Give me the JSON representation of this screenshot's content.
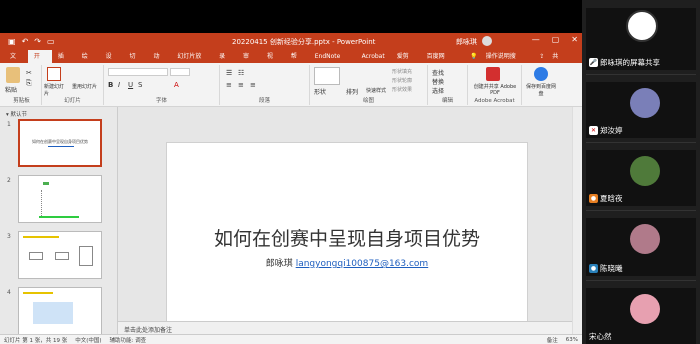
{
  "window": {
    "title": "20220415 创新经验分享.pptx - PowerPoint",
    "user": "郎咏琪"
  },
  "tabs": [
    "文件",
    "开始",
    "插入",
    "绘图",
    "设计",
    "切换",
    "动画",
    "幻灯片放映",
    "录制",
    "审阅",
    "视图",
    "帮助",
    "EndNote 20",
    "Acrobat",
    "爱剪辑",
    "百度网盘"
  ],
  "tell_me": "操作说明搜索",
  "share": "共享",
  "ribbon": {
    "groups": [
      "剪贴板",
      "幻灯片",
      "字体",
      "段落",
      "绘图",
      "编辑",
      "Adobe Acrobat",
      "保存到百度网盘"
    ],
    "paste": "粘贴",
    "new_slide": "新建幻灯片",
    "reuse": "重用幻灯片",
    "shapes": "形状",
    "arrange": "排列",
    "quick_styles": "快速样式",
    "fill": "形状填充",
    "outline": "形状轮廓",
    "effects": "形状效果",
    "find": "查找",
    "replace": "替换",
    "select": "选择",
    "create_pdf": "创建并共享 Adobe PDF",
    "save_baidu": "保存到百度网盘"
  },
  "thumbs": {
    "section": "默认节",
    "numbers": [
      "1",
      "2",
      "3",
      "4"
    ],
    "slide1_title": "如何在创赛中呈现自身项目优势"
  },
  "slide": {
    "title": "如何在创赛中呈现自身项目优势",
    "author": "郎咏琪",
    "email": "langyongqi100875@163.com"
  },
  "notes": "单击此处添加备注",
  "status": {
    "slide": "幻灯片 第 1 张，共 19 张",
    "lang": "中文(中国)",
    "access": "辅助功能: 调查",
    "notes": "备注",
    "zoom": "63%"
  },
  "gallery": {
    "screen_share": "郎咏琪的屏幕共享",
    "participants": [
      {
        "name": "郑汝婷",
        "color": "#7a7fb8"
      },
      {
        "name": "夏晗夜",
        "color": "#4f7a3a"
      },
      {
        "name": "陈晓曦",
        "color": "#b07a8a"
      },
      {
        "name": "宋心然",
        "color": "#e7a0b0"
      }
    ]
  }
}
